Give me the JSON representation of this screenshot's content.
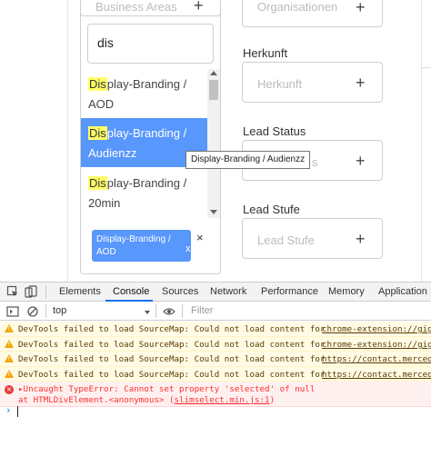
{
  "form": {
    "business_areas_placeholder": "Business Areas",
    "organisationen_placeholder": "Organisationen",
    "search_value": "dis",
    "options": [
      {
        "match": "Dis",
        "rest": "play-Branding /",
        "line2": "AOD"
      },
      {
        "match": "Dis",
        "rest": "play-Branding /",
        "line2": "Audienzz"
      },
      {
        "match": "Dis",
        "rest": "play-Branding /",
        "line2": "20min"
      }
    ],
    "selected_chip": {
      "line1": "Display-Branding /",
      "line2": "AOD",
      "close": "x"
    },
    "remove_symbol": "×",
    "tooltip": "Display-Branding / Audienzz",
    "herkunft_label": "Herkunft",
    "herkunft_placeholder": "Herkunft",
    "lead_status_label": "Lead Status",
    "lead_status_placeholder_tail": "s",
    "lead_stufe_label": "Lead Stufe",
    "lead_stufe_placeholder": "Lead Stufe",
    "plus_symbol": "+"
  },
  "devtools": {
    "tabs": [
      "Elements",
      "Console",
      "Sources",
      "Network",
      "Performance",
      "Memory",
      "Application"
    ],
    "active_tab": "Console",
    "context": "top",
    "filter_placeholder": "Filter",
    "messages": [
      {
        "level": "warning",
        "text": "DevTools failed to load SourceMap: Could not load content for ",
        "link": "chrome-extension://gig"
      },
      {
        "level": "warning",
        "text": "DevTools failed to load SourceMap: Could not load content for ",
        "link": "chrome-extension://gig"
      },
      {
        "level": "warning",
        "text": "DevTools failed to load SourceMap: Could not load content for ",
        "link": "https://contact.merced"
      },
      {
        "level": "warning",
        "text": "DevTools failed to load SourceMap: Could not load content for ",
        "link": "https://contact.merced"
      },
      {
        "level": "error",
        "text": "Uncaught TypeError: Cannot set property 'selected' of null",
        "text2": "    at HTMLDivElement.<anonymous> (",
        "link": "slimselect.min.js:1",
        "tail": ")"
      }
    ],
    "prompt_symbol": "›"
  },
  "colors": {
    "select_highlight": "#5897fb",
    "match_highlight": "#ffff66",
    "warning_bg": "#fffbe5",
    "error_text": "#fe2f2f",
    "active_tab_underline": "#1a73e8"
  }
}
